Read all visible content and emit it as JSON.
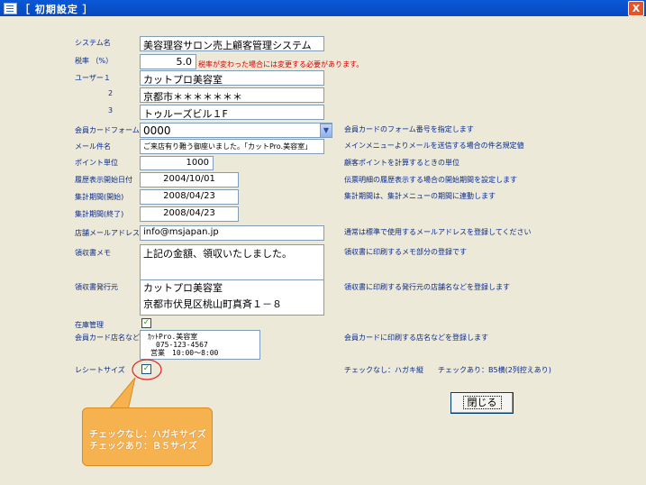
{
  "window": {
    "title": "［ 初期設定 ］",
    "close_glyph": "X"
  },
  "fields": {
    "system_name": {
      "label": "システム名",
      "value": "美容理容サロン売上顧客管理システム"
    },
    "tax_rate": {
      "label": "税率 （%）",
      "value": "5.0",
      "note": "税率が変わった場合には変更する必要があります。"
    },
    "user1": {
      "label": "ユーザー１",
      "value": "カットプロ美容室"
    },
    "user2": {
      "label": "2",
      "value": "京都市＊＊＊＊＊＊＊"
    },
    "user3": {
      "label": "3",
      "value": "トゥルーズビル１F"
    },
    "member_card_form": {
      "label": "会員カードフォーム",
      "value": "0000",
      "help": "会員カードのフォーム番号を指定します"
    },
    "mail_subject": {
      "label": "メール件名",
      "value": "ご来店有り難う御座いました。「カットPro.美容室」",
      "help": "メインメニューよりメールを送信する場合の件名規定値"
    },
    "point_unit": {
      "label": "ポイント単位",
      "value": "1000",
      "help": "顧客ポイントを計算するときの単位"
    },
    "history_start": {
      "label": "履歴表示開始日付",
      "value": "2004/10/01",
      "help": "伝票明細の履歴表示する場合の開始期間を設定します"
    },
    "period_start": {
      "label": "集計期間(開始)",
      "value": "2008/04/23",
      "help": "集計期間は、集計メニューの期間に連動します"
    },
    "period_end": {
      "label": "集計期間(終了)",
      "value": "2008/04/23"
    },
    "shop_email": {
      "label": "店舗メールアドレス",
      "value": "info@msjapan.jp",
      "help": "通常は標準で使用するメールアドレスを登録してください"
    },
    "receipt_memo": {
      "label": "領収書メモ",
      "value": "上記の金額、領収いたしました。",
      "help": "領収書に印刷するメモ部分の登録です"
    },
    "receipt_issuer": {
      "label": "領収書発行元",
      "line1": "カットプロ美容室",
      "line2": "京都市伏見区桃山町真斉１－８",
      "help": "領収書に印刷する発行元の店舗名などを登録します"
    },
    "inventory": {
      "label": "在庫管理",
      "checked": true
    },
    "card_shop_name": {
      "label": "会員カード店名など",
      "line1": "ｶｯﾄPro.美容室",
      "line2": "075-123-4567",
      "line3": "営業　10:00～8:00",
      "help": "会員カードに印刷する店名などを登録します"
    },
    "receipt_size": {
      "label": "レシートサイズ",
      "checked": true,
      "help": "チェックなし：ハガキ縦　　チェックあり：B5横(2列控えあり)"
    }
  },
  "buttons": {
    "close": "閉じる"
  },
  "callout": {
    "line1": "チェックなし：ハガキサイズ",
    "line2": "チェックあり：Ｂ５サイズ"
  },
  "colors": {
    "label_text": "#0a2a8c",
    "note_red": "#d80000",
    "callout_bg": "#f6b24f",
    "highlight_ring": "#e02020",
    "background": "#ece9d8"
  }
}
